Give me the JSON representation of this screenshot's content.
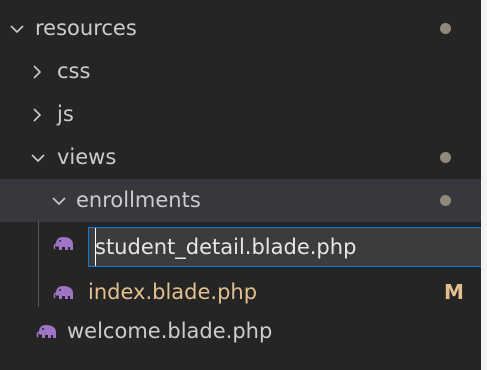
{
  "tree": {
    "resources": {
      "label": "resources"
    },
    "css": {
      "label": "css"
    },
    "js": {
      "label": "js"
    },
    "views": {
      "label": "views"
    },
    "enrollments": {
      "label": "enrollments"
    },
    "rename_input": {
      "value": "student_detail.blade.php"
    },
    "index_file": {
      "label": "index.blade.php",
      "git_status": "M"
    },
    "welcome_file": {
      "label": "welcome.blade.php"
    }
  },
  "icons": {
    "chevron_down": "chevron-down-icon",
    "chevron_right": "chevron-right-icon",
    "blade_file": "elephant-icon",
    "modified_dot": "modified-dot-icon"
  },
  "colors": {
    "background": "#252526",
    "selected_row": "#37373d",
    "text": "#cccccc",
    "modified_text": "#e2c08d",
    "focus_border": "#0e7ad3",
    "blade_icon": "#a074c4",
    "dot": "#8f8a7a"
  }
}
